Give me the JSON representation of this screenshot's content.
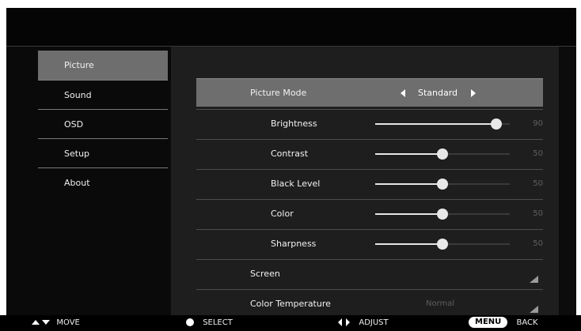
{
  "nav": {
    "items": [
      {
        "label": "Picture",
        "active": true
      },
      {
        "label": "Sound",
        "active": false
      },
      {
        "label": "OSD",
        "active": false
      },
      {
        "label": "Setup",
        "active": false
      },
      {
        "label": "About",
        "active": false
      }
    ]
  },
  "picture_mode": {
    "label": "Picture Mode",
    "value": "Standard"
  },
  "settings": [
    {
      "label": "Brightness",
      "value": "90",
      "level": 90
    },
    {
      "label": "Contrast",
      "value": "50",
      "level": 50
    },
    {
      "label": "Black Level",
      "value": "50",
      "level": 50
    },
    {
      "label": "Color",
      "value": "50",
      "level": 50
    },
    {
      "label": "Sharpness",
      "value": "50",
      "level": 50
    }
  ],
  "screen": {
    "label": "Screen"
  },
  "color_temperature": {
    "label": "Color Temperature",
    "value": "Normal"
  },
  "footer": {
    "move": "MOVE",
    "select": "SELECT",
    "adjust": "ADJUST",
    "menu": "MENU",
    "back": "BACK"
  }
}
